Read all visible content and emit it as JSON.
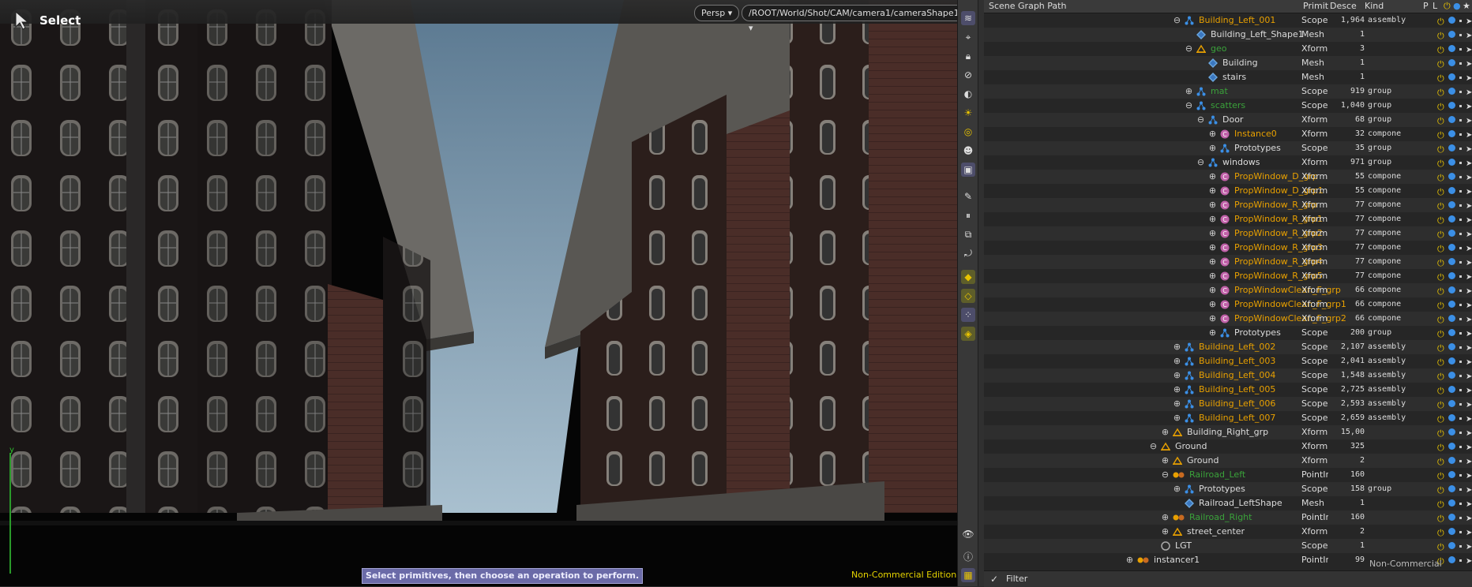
{
  "viewport": {
    "tool_name": "Select",
    "projection": "Persp",
    "camera_path": "/ROOT/World/Shot/CAM/camera1/cameraShape1",
    "hint": "Select primitives, then choose an operation to perform.",
    "edition": "Non-Commercial Edition",
    "axis_label": "y"
  },
  "tree": {
    "columns": [
      "Scene Graph Path",
      "Primiti",
      "Descen",
      "Kind",
      "P",
      "L"
    ],
    "filter_label": "Filter",
    "edition_overlay": "Non-Commercial Edition",
    "rows": [
      {
        "name": "Building_Left_001",
        "prim": "Scope",
        "desc": "1,964",
        "kind": "assembly",
        "indent": 1,
        "icon": "scope",
        "color": "#e8a000",
        "exp": "minus"
      },
      {
        "name": "Building_Left_Shape1",
        "prim": "Mesh",
        "desc": "1",
        "kind": "",
        "indent": 2,
        "icon": "mesh",
        "color": "#dcdcdc",
        "exp": ""
      },
      {
        "name": "geo",
        "prim": "Xform",
        "desc": "3",
        "kind": "",
        "indent": 2,
        "icon": "xform",
        "color": "#3aa23a",
        "exp": "minus"
      },
      {
        "name": "Building",
        "prim": "Mesh",
        "desc": "1",
        "kind": "",
        "indent": 3,
        "icon": "mesh",
        "color": "#dcdcdc",
        "exp": ""
      },
      {
        "name": "stairs",
        "prim": "Mesh",
        "desc": "1",
        "kind": "",
        "indent": 3,
        "icon": "mesh",
        "color": "#dcdcdc",
        "exp": ""
      },
      {
        "name": "mat",
        "prim": "Scope",
        "desc": "919",
        "kind": "group",
        "indent": 2,
        "icon": "scope",
        "color": "#3aa23a",
        "exp": "plus"
      },
      {
        "name": "scatters",
        "prim": "Scope",
        "desc": "1,040",
        "kind": "group",
        "indent": 2,
        "icon": "scope",
        "color": "#3aa23a",
        "exp": "minus"
      },
      {
        "name": "Door",
        "prim": "Xform",
        "desc": "68",
        "kind": "group",
        "indent": 3,
        "icon": "scope",
        "color": "#dcdcdc",
        "exp": "minus"
      },
      {
        "name": "Instance0",
        "prim": "Xform",
        "desc": "32",
        "kind": "compone",
        "indent": 4,
        "icon": "comp",
        "color": "#e8a000",
        "exp": "plus"
      },
      {
        "name": "Prototypes",
        "prim": "Scope",
        "desc": "35",
        "kind": "group",
        "indent": 4,
        "icon": "scope",
        "color": "#dcdcdc",
        "exp": "plus"
      },
      {
        "name": "windows",
        "prim": "Xform",
        "desc": "971",
        "kind": "group",
        "indent": 3,
        "icon": "scope",
        "color": "#dcdcdc",
        "exp": "minus"
      },
      {
        "name": "PropWindow_D_grp",
        "prim": "Xform",
        "desc": "55",
        "kind": "compone",
        "indent": 4,
        "icon": "comp",
        "color": "#e8a000",
        "exp": "plus"
      },
      {
        "name": "PropWindow_D_grp1",
        "prim": "Xform",
        "desc": "55",
        "kind": "compone",
        "indent": 4,
        "icon": "comp",
        "color": "#e8a000",
        "exp": "plus"
      },
      {
        "name": "PropWindow_R_grp",
        "prim": "Xform",
        "desc": "77",
        "kind": "compone",
        "indent": 4,
        "icon": "comp",
        "color": "#e8a000",
        "exp": "plus"
      },
      {
        "name": "PropWindow_R_grp1",
        "prim": "Xform",
        "desc": "77",
        "kind": "compone",
        "indent": 4,
        "icon": "comp",
        "color": "#e8a000",
        "exp": "plus"
      },
      {
        "name": "PropWindow_R_grp2",
        "prim": "Xform",
        "desc": "77",
        "kind": "compone",
        "indent": 4,
        "icon": "comp",
        "color": "#e8a000",
        "exp": "plus"
      },
      {
        "name": "PropWindow_R_grp3",
        "prim": "Xform",
        "desc": "77",
        "kind": "compone",
        "indent": 4,
        "icon": "comp",
        "color": "#e8a000",
        "exp": "plus"
      },
      {
        "name": "PropWindow_R_grp4",
        "prim": "Xform",
        "desc": "77",
        "kind": "compone",
        "indent": 4,
        "icon": "comp",
        "color": "#e8a000",
        "exp": "plus"
      },
      {
        "name": "PropWindow_R_grp5",
        "prim": "Xform",
        "desc": "77",
        "kind": "compone",
        "indent": 4,
        "icon": "comp",
        "color": "#e8a000",
        "exp": "plus"
      },
      {
        "name": "PropWindowClean_F_grp",
        "prim": "Xform",
        "desc": "66",
        "kind": "compone",
        "indent": 4,
        "icon": "comp",
        "color": "#e8a000",
        "exp": "plus"
      },
      {
        "name": "PropWindowClean_F_grp1",
        "prim": "Xform",
        "desc": "66",
        "kind": "compone",
        "indent": 4,
        "icon": "comp",
        "color": "#e8a000",
        "exp": "plus"
      },
      {
        "name": "PropWindowClean_F_grp2",
        "prim": "Xform",
        "desc": "66",
        "kind": "compone",
        "indent": 4,
        "icon": "comp",
        "color": "#e8a000",
        "exp": "plus"
      },
      {
        "name": "Prototypes",
        "prim": "Scope",
        "desc": "200",
        "kind": "group",
        "indent": 4,
        "icon": "scope",
        "color": "#dcdcdc",
        "exp": "plus"
      },
      {
        "name": "Building_Left_002",
        "prim": "Scope",
        "desc": "2,107",
        "kind": "assembly",
        "indent": 1,
        "icon": "scope",
        "color": "#e8a000",
        "exp": "plus"
      },
      {
        "name": "Building_Left_003",
        "prim": "Scope",
        "desc": "2,041",
        "kind": "assembly",
        "indent": 1,
        "icon": "scope",
        "color": "#e8a000",
        "exp": "plus"
      },
      {
        "name": "Building_Left_004",
        "prim": "Scope",
        "desc": "1,548",
        "kind": "assembly",
        "indent": 1,
        "icon": "scope",
        "color": "#e8a000",
        "exp": "plus"
      },
      {
        "name": "Building_Left_005",
        "prim": "Scope",
        "desc": "2,725",
        "kind": "assembly",
        "indent": 1,
        "icon": "scope",
        "color": "#e8a000",
        "exp": "plus"
      },
      {
        "name": "Building_Left_006",
        "prim": "Scope",
        "desc": "2,593",
        "kind": "assembly",
        "indent": 1,
        "icon": "scope",
        "color": "#e8a000",
        "exp": "plus"
      },
      {
        "name": "Building_Left_007",
        "prim": "Scope",
        "desc": "2,659",
        "kind": "assembly",
        "indent": 1,
        "icon": "scope",
        "color": "#e8a000",
        "exp": "plus"
      },
      {
        "name": "Building_Right_grp",
        "prim": "Xform",
        "desc": "15,00",
        "kind": "",
        "indent": 0,
        "icon": "xform",
        "color": "#dcdcdc",
        "exp": "plus"
      },
      {
        "name": "Ground",
        "prim": "Xform",
        "desc": "325",
        "kind": "",
        "indent": -1,
        "icon": "xform",
        "color": "#dcdcdc",
        "exp": "minus"
      },
      {
        "name": "Ground",
        "prim": "Xform",
        "desc": "2",
        "kind": "",
        "indent": 0,
        "icon": "xform",
        "color": "#dcdcdc",
        "exp": "plus"
      },
      {
        "name": "Railroad_Left",
        "prim": "PointIns",
        "desc": "160",
        "kind": "",
        "indent": 0,
        "icon": "pointins",
        "color": "#3aa23a",
        "exp": "minus"
      },
      {
        "name": "Prototypes",
        "prim": "Scope",
        "desc": "158",
        "kind": "group",
        "indent": 1,
        "icon": "scope",
        "color": "#dcdcdc",
        "exp": "plus"
      },
      {
        "name": "Railroad_LeftShape",
        "prim": "Mesh",
        "desc": "1",
        "kind": "",
        "indent": 1,
        "icon": "mesh",
        "color": "#dcdcdc",
        "exp": ""
      },
      {
        "name": "Railroad_Right",
        "prim": "PointIns",
        "desc": "160",
        "kind": "",
        "indent": 0,
        "icon": "pointins",
        "color": "#3aa23a",
        "exp": "plus"
      },
      {
        "name": "street_center",
        "prim": "Xform",
        "desc": "2",
        "kind": "",
        "indent": 0,
        "icon": "xform",
        "color": "#dcdcdc",
        "exp": "plus"
      },
      {
        "name": "LGT",
        "prim": "Scope",
        "desc": "1",
        "kind": "",
        "indent": -1,
        "icon": "lgt",
        "color": "#dcdcdc",
        "exp": ""
      },
      {
        "name": "instancer1",
        "prim": "PointIns",
        "desc": "99",
        "kind": "",
        "indent": -3,
        "icon": "pointins",
        "color": "#dcdcdc",
        "exp": "plus"
      }
    ]
  }
}
